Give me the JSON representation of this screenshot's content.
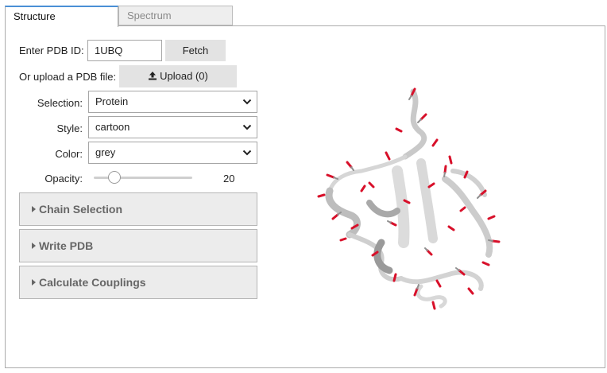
{
  "tabs": [
    {
      "label": "Structure",
      "active": true
    },
    {
      "label": "Spectrum",
      "active": false
    }
  ],
  "pdb": {
    "id_label": "Enter PDB ID:",
    "id_value": "1UBQ",
    "fetch_label": "Fetch",
    "upload_label": "Or upload a PDB file:",
    "upload_button": "Upload (0)"
  },
  "controls": {
    "selection": {
      "label": "Selection:",
      "value": "Protein"
    },
    "style": {
      "label": "Style:",
      "value": "cartoon"
    },
    "color": {
      "label": "Color:",
      "value": "grey"
    },
    "opacity": {
      "label": "Opacity:",
      "value": "20",
      "fraction": 0.2
    }
  },
  "accordions": [
    {
      "label": "Chain Selection"
    },
    {
      "label": "Write PDB"
    },
    {
      "label": "Calculate Couplings"
    }
  ],
  "icons": {
    "upload": "upload-icon",
    "dropdown": "chevron-down-icon",
    "collapsed": "caret-right-icon"
  },
  "colors": {
    "accent": "#4a8fd6",
    "ribbon": "#d4d4d4",
    "oxygen": "#e0102a"
  }
}
